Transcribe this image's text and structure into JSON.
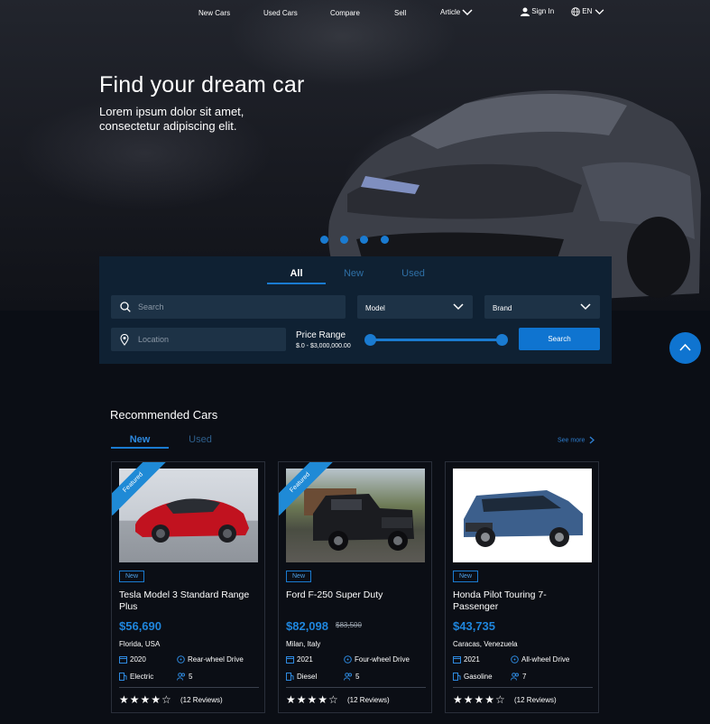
{
  "nav": {
    "items": [
      "New Cars",
      "Used Cars",
      "Compare",
      "Sell",
      "Article"
    ],
    "sign_in": "Sign In",
    "language": "EN"
  },
  "hero": {
    "title": "Find your dream car",
    "subtitle": "Lorem ipsum dolor sit amet, consectetur adipiscing elit.",
    "slide_count": 4
  },
  "search": {
    "tabs": [
      "All",
      "New",
      "Used"
    ],
    "active_tab": "All",
    "search_placeholder": "Search",
    "location_placeholder": "Location",
    "model_label": "Model",
    "brand_label": "Brand",
    "price_label": "Price Range",
    "price_range": "$.0 - $3,000,000.00",
    "price_slider_min_fraction": 0,
    "price_slider_max_fraction": 1,
    "button_label": "Search"
  },
  "recommended": {
    "title": "Recommended Cars",
    "tabs": [
      "New",
      "Used"
    ],
    "see_more": "See more",
    "cards": [
      {
        "featured": true,
        "featured_label": "Featured",
        "badge": "New",
        "name": "Tesla Model 3 Standard Range Plus",
        "price": "$56,690",
        "old_price": "",
        "location": "Florida, USA",
        "year": "2020",
        "drive": "Rear-wheel Drive",
        "fuel": "Electric",
        "seats": "5",
        "rating": 4,
        "reviews": "(12 Reviews)"
      },
      {
        "featured": true,
        "featured_label": "Featured",
        "badge": "New",
        "name": "Ford F-250 Super Duty",
        "price": "$82,098",
        "old_price": "$83,500",
        "location": "Milan, Italy",
        "year": "2021",
        "drive": "Four-wheel Drive",
        "fuel": "Diesel",
        "seats": "5",
        "rating": 4,
        "reviews": "(12 Reviews)"
      },
      {
        "featured": false,
        "featured_label": "",
        "badge": "New",
        "name": "Honda Pilot Touring 7-Passenger",
        "price": "$43,735",
        "old_price": "",
        "location": "Caracas, Venezuela",
        "year": "2021",
        "drive": "All-wheel Drive",
        "fuel": "Gasoline",
        "seats": "7",
        "rating": 4,
        "reviews": "(12 Reviews)"
      }
    ]
  },
  "colors": {
    "accent": "#1a7bd1",
    "background": "#0b0e15",
    "panel": "#0f2133",
    "field": "#1d3246",
    "price": "#1f86dd"
  }
}
